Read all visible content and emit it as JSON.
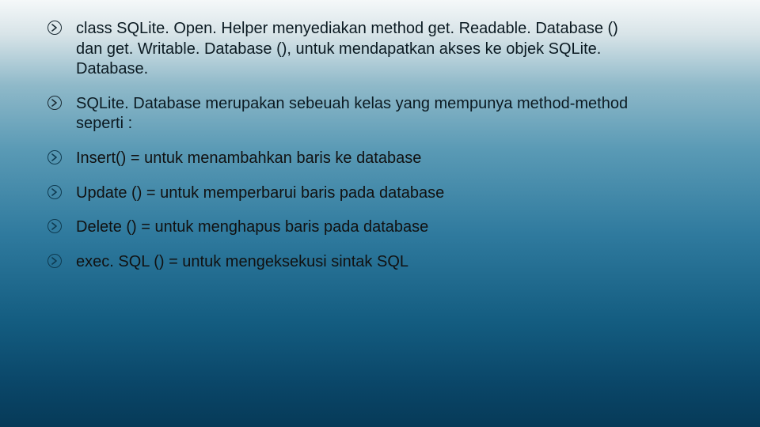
{
  "bullets": [
    {
      "text": "class SQLite. Open. Helper menyediakan method get. Readable. Database () dan get. Writable. Database (), untuk mendapatkan akses ke objek SQLite. Database."
    },
    {
      "text": "SQLite. Database merupakan sebeuah kelas yang mempunya method-method seperti :"
    },
    {
      "text": "Insert() = untuk menambahkan baris ke database"
    },
    {
      "text": "Update () = untuk memperbarui baris pada database"
    },
    {
      "text": "Delete ()  = untuk menghapus baris pada database"
    },
    {
      "text": "exec. SQL ()  = untuk mengeksekusi sintak SQL"
    }
  ]
}
